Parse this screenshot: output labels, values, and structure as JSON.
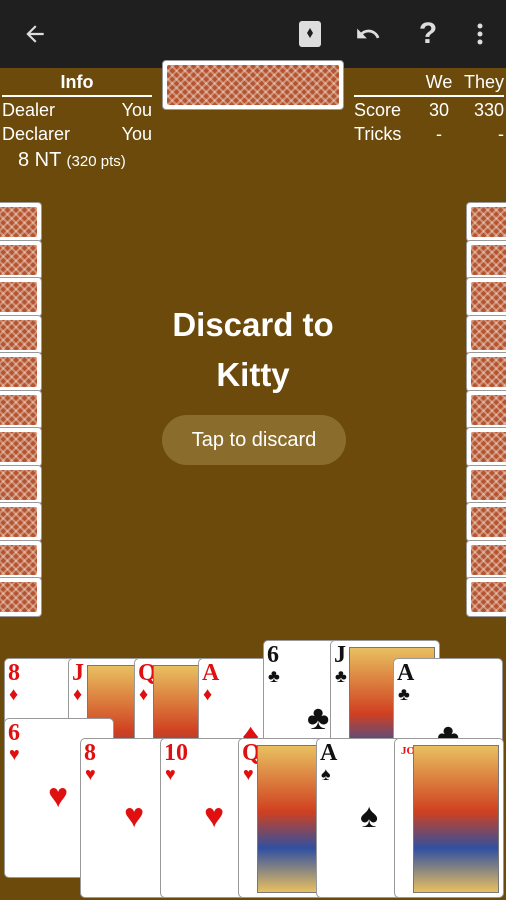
{
  "topbar": {
    "back_icon": "arrow-back-icon",
    "cards_icon": "card-deck-icon",
    "undo_icon": "undo-icon",
    "help_label": "?",
    "more_icon": "more-vert-icon"
  },
  "info": {
    "title": "Info",
    "dealer_label": "Dealer",
    "dealer_value": "You",
    "declarer_label": "Declarer",
    "declarer_value": "You",
    "contract": "8 NT",
    "contract_points": "(320 pts)"
  },
  "score": {
    "we_label": "We",
    "they_label": "They",
    "score_label": "Score",
    "score_we": "30",
    "score_they": "330",
    "tricks_label": "Tricks",
    "tricks_we": "-",
    "tricks_they": "-"
  },
  "message": {
    "line1": "Discard to",
    "line2": "Kitty"
  },
  "discard_button": "Tap to discard",
  "hand_back_row": [
    {
      "rank": "8",
      "suit": "♦",
      "color": "red"
    },
    {
      "rank": "J",
      "suit": "♦",
      "color": "red"
    },
    {
      "rank": "Q",
      "suit": "♦",
      "color": "red"
    },
    {
      "rank": "A",
      "suit": "♦",
      "color": "red"
    },
    {
      "rank": "6",
      "suit": "♣",
      "color": "black"
    },
    {
      "rank": "J",
      "suit": "♣",
      "color": "black"
    },
    {
      "rank": "A",
      "suit": "♣",
      "color": "black"
    }
  ],
  "hand_front_row": [
    {
      "rank": "6",
      "suit": "♥",
      "color": "red"
    },
    {
      "rank": "8",
      "suit": "♥",
      "color": "red"
    },
    {
      "rank": "10",
      "suit": "♥",
      "color": "red"
    },
    {
      "rank": "Q",
      "suit": "♥",
      "color": "red"
    },
    {
      "rank": "A",
      "suit": "♠",
      "color": "black"
    },
    {
      "rank": "JOKER",
      "suit": "",
      "color": "red"
    }
  ]
}
